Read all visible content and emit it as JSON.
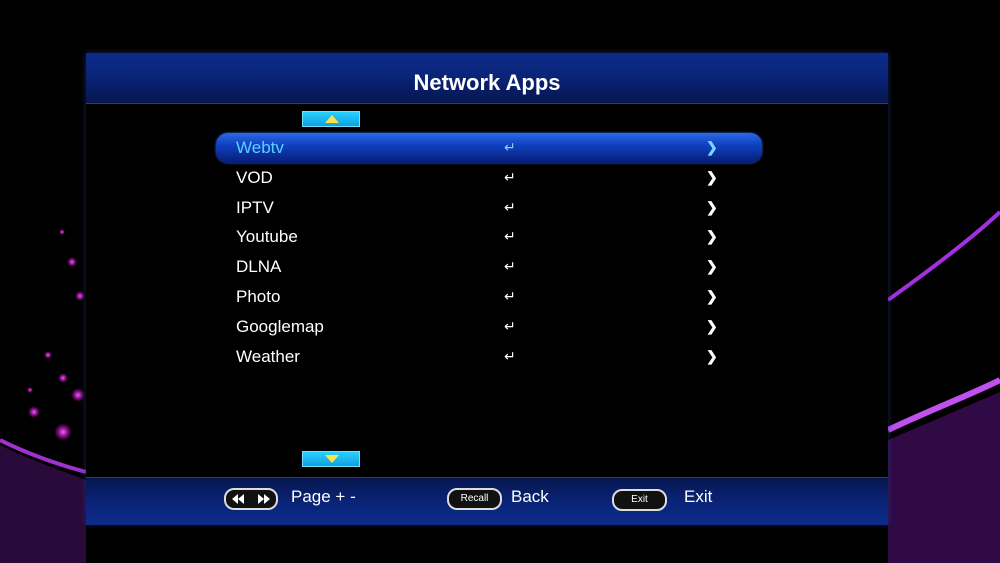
{
  "title": "Network Apps",
  "colors": {
    "accent": "#5ed0ff",
    "header_blue": "#0a2478",
    "highlight": "#1a4ad0"
  },
  "menu": {
    "items": [
      {
        "label": "Webtv",
        "selected": true
      },
      {
        "label": "VOD"
      },
      {
        "label": "IPTV"
      },
      {
        "label": "Youtube"
      },
      {
        "label": "DLNA"
      },
      {
        "label": "Photo"
      },
      {
        "label": "Googlemap"
      },
      {
        "label": "Weather"
      }
    ],
    "enter_icon": "enter-return-icon",
    "arrow_icon": "chevron-right-icon"
  },
  "footer": {
    "page": {
      "key_icon": "rewind-forward-icon",
      "label": "Page + -"
    },
    "back": {
      "key": "Recall",
      "label": "Back"
    },
    "exit": {
      "key": "Exit",
      "label": "Exit"
    }
  }
}
